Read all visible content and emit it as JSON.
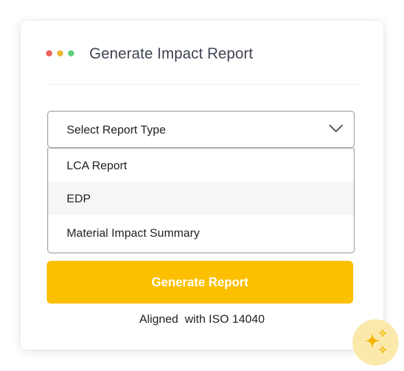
{
  "window": {
    "title": "Generate Impact Report"
  },
  "report_select": {
    "selected_label": "Select Report Type",
    "options": [
      {
        "label": "LCA Report"
      },
      {
        "label": "EDP"
      },
      {
        "label": "Material Impact Summary"
      }
    ],
    "hovered_option": "EDP"
  },
  "actions": {
    "generate_label": "Generate Report"
  },
  "caption": "Aligned  with ISO 14040",
  "icons": {
    "window_controls": [
      "red-dot",
      "yellow-dot",
      "green-dot"
    ],
    "dropdown": "chevron-down-icon",
    "assistant": "sparkle-icon"
  },
  "colors": {
    "accent": "#fcc000",
    "sparkle_bg": "#fbe9ab",
    "dot_red": "#f0605b",
    "dot_yellow": "#f5b731",
    "dot_green": "#5dcf7d"
  }
}
